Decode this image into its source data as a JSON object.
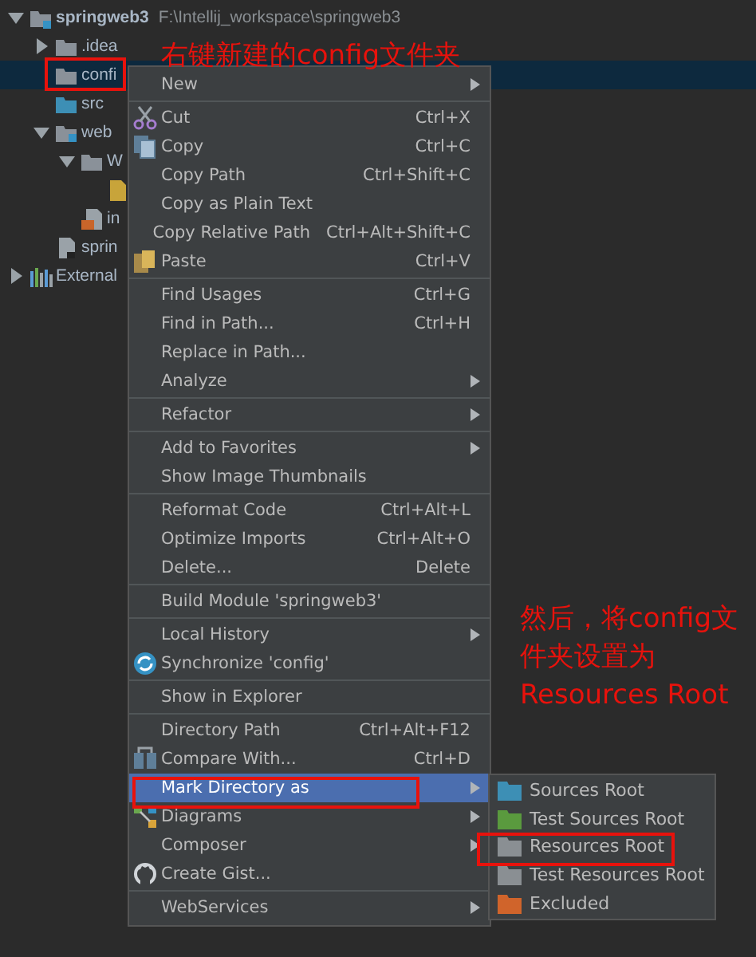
{
  "tree": [
    {
      "label": "springweb3",
      "path": "F:\\Intellij_workspace\\springweb3",
      "kind": "module",
      "expanded": true,
      "selected": false,
      "children": [
        {
          "label": ".idea",
          "kind": "folder",
          "expanded": false,
          "selected": false
        },
        {
          "label": "confi",
          "kind": "folder",
          "selected": true
        },
        {
          "label": "src",
          "kind": "source",
          "selected": false
        },
        {
          "label": "web",
          "kind": "web",
          "expanded": true,
          "selected": false,
          "children": [
            {
              "label": "W",
              "kind": "folder",
              "expanded": true,
              "selected": false,
              "children": [
                {
                  "kind": "xml",
                  "selected": false
                }
              ]
            },
            {
              "label": "in",
              "kind": "jsp",
              "selected": false
            }
          ]
        },
        {
          "label": "sprin",
          "kind": "file",
          "selected": false
        }
      ]
    },
    {
      "label": "External",
      "kind": "library",
      "expanded": false,
      "selected": false
    }
  ],
  "context_menu": [
    {
      "kind": "item",
      "label": "New",
      "submenu": true,
      "selected": false
    },
    {
      "kind": "separator"
    },
    {
      "kind": "item",
      "label": "Cut",
      "shortcut": "Ctrl+X",
      "selected": false
    },
    {
      "kind": "item",
      "label": "Copy",
      "shortcut": "Ctrl+C",
      "selected": false
    },
    {
      "kind": "item",
      "label": "Copy Path",
      "shortcut": "Ctrl+Shift+C",
      "selected": false
    },
    {
      "kind": "item",
      "label": "Copy as Plain Text",
      "selected": false
    },
    {
      "kind": "item",
      "label": "Copy Relative Path",
      "shortcut": "Ctrl+Alt+Shift+C",
      "selected": false
    },
    {
      "kind": "item",
      "label": "Paste",
      "shortcut": "Ctrl+V",
      "selected": false
    },
    {
      "kind": "separator"
    },
    {
      "kind": "item",
      "label": "Find Usages",
      "shortcut": "Ctrl+G",
      "selected": false
    },
    {
      "kind": "item",
      "label": "Find in Path...",
      "shortcut": "Ctrl+H",
      "selected": false
    },
    {
      "kind": "item",
      "label": "Replace in Path...",
      "selected": false
    },
    {
      "kind": "item",
      "label": "Analyze",
      "submenu": true,
      "selected": false
    },
    {
      "kind": "separator"
    },
    {
      "kind": "item",
      "label": "Refactor",
      "submenu": true,
      "selected": false
    },
    {
      "kind": "separator"
    },
    {
      "kind": "item",
      "label": "Add to Favorites",
      "submenu": true,
      "selected": false
    },
    {
      "kind": "item",
      "label": "Show Image Thumbnails",
      "selected": false
    },
    {
      "kind": "separator"
    },
    {
      "kind": "item",
      "label": "Reformat Code",
      "shortcut": "Ctrl+Alt+L",
      "selected": false
    },
    {
      "kind": "item",
      "label": "Optimize Imports",
      "shortcut": "Ctrl+Alt+O",
      "selected": false
    },
    {
      "kind": "item",
      "label": "Delete...",
      "shortcut": "Delete",
      "selected": false
    },
    {
      "kind": "separator"
    },
    {
      "kind": "item",
      "label": "Build Module 'springweb3'",
      "selected": false
    },
    {
      "kind": "separator"
    },
    {
      "kind": "item",
      "label": "Local History",
      "submenu": true,
      "selected": false
    },
    {
      "kind": "item",
      "label": "Synchronize 'config'",
      "selected": false
    },
    {
      "kind": "separator"
    },
    {
      "kind": "item",
      "label": "Show in Explorer",
      "selected": false
    },
    {
      "kind": "separator"
    },
    {
      "kind": "item",
      "label": "Directory Path",
      "shortcut": "Ctrl+Alt+F12",
      "selected": false
    },
    {
      "kind": "item",
      "label": "Compare With...",
      "shortcut": "Ctrl+D",
      "selected": false
    },
    {
      "kind": "item",
      "label": "Mark Directory as",
      "submenu": true,
      "selected": true
    },
    {
      "kind": "item",
      "label": "Diagrams",
      "submenu": true,
      "selected": false
    },
    {
      "kind": "item",
      "label": "Composer",
      "submenu": true,
      "selected": false
    },
    {
      "kind": "item",
      "label": "Create Gist...",
      "selected": false
    },
    {
      "kind": "separator"
    },
    {
      "kind": "item",
      "label": "WebServices",
      "submenu": true,
      "selected": false
    }
  ],
  "submenu": [
    {
      "label": "Sources Root",
      "color": "#3d8fb5",
      "selected": false
    },
    {
      "label": "Test Sources Root",
      "color": "#5a9a3e",
      "selected": false
    },
    {
      "label": "Resources Root",
      "color": "#8a8f93",
      "selected": false
    },
    {
      "label": "Test Resources Root",
      "color": "#8a8f93",
      "selected": false
    },
    {
      "label": "Excluded",
      "color": "#d0642b",
      "selected": false
    }
  ],
  "annotations": [
    {
      "lines": [
        "右键新建的config文件夹"
      ]
    },
    {
      "lines": [
        "然后，将config文",
        "件夹设置为",
        "Resources Root"
      ]
    }
  ]
}
